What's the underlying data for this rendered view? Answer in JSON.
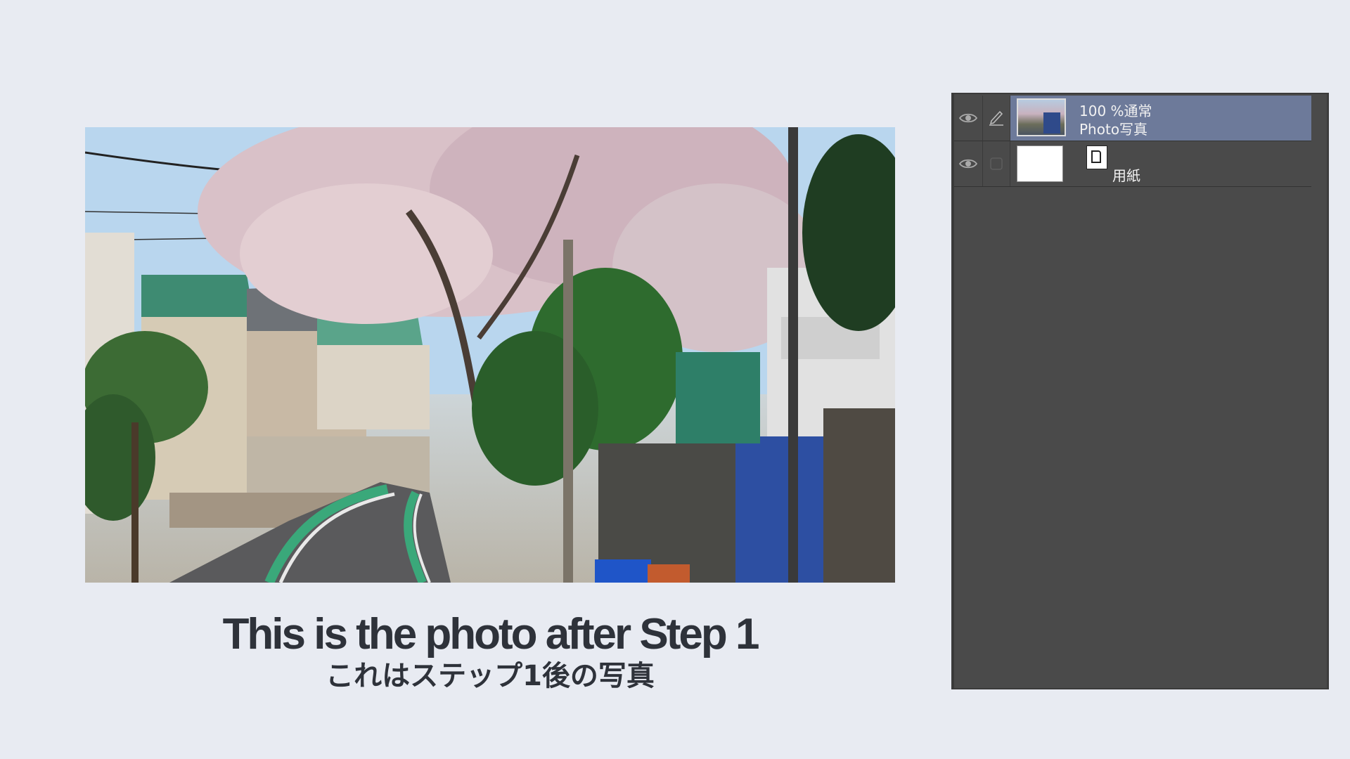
{
  "caption": {
    "title_en": "This is the photo after Step 1",
    "title_jp": "これはステップ1後の写真"
  },
  "layer_panel": {
    "layers": [
      {
        "opacity_blend": "100 %通常",
        "name": "Photo写真",
        "visible": true,
        "selected": true,
        "icon": "pen-icon"
      },
      {
        "name": "用紙",
        "visible": true,
        "selected": false,
        "icon": "paper-icon"
      }
    ]
  },
  "colors": {
    "page_background": "#e8ebf2",
    "panel_background": "#4a4a4a",
    "selected_layer": "#6d7a9a",
    "caption_text": "#2e323a"
  }
}
